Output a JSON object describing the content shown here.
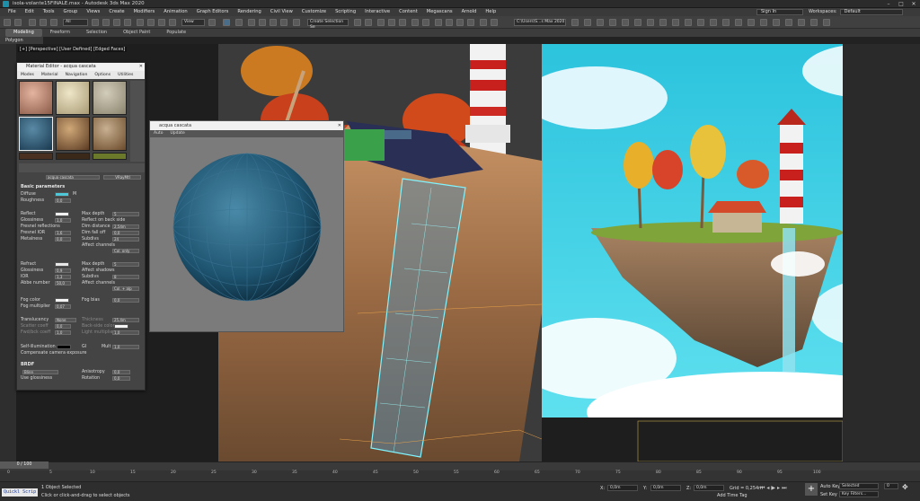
{
  "window": {
    "title": "isola-volante15FINALE.max - Autodesk 3ds Max 2020",
    "min": "–",
    "max": "□",
    "close": "✕"
  },
  "menu": [
    "File",
    "Edit",
    "Tools",
    "Group",
    "Views",
    "Create",
    "Modifiers",
    "Animation",
    "Graph Editors",
    "Rendering",
    "Civil View",
    "Customize",
    "Scripting",
    "Interactive",
    "Content",
    "Megascans",
    "Arnold",
    "Help"
  ],
  "signin": "Sign In",
  "workspace": {
    "label": "Workspaces:",
    "value": "Default"
  },
  "toolbar": {
    "view_dropdown": "View",
    "selection_set": "Create Selection Se",
    "path": "C:\\Users\\S...s Max 2020"
  },
  "ribbon": {
    "tabs": [
      "Modeling",
      "Freeform",
      "Selection",
      "Object Paint",
      "Populate"
    ],
    "active": "Modeling",
    "sub": "Polygon Modeling"
  },
  "viewport": {
    "label": "[+] [Perspective] [User Defined] [Edged Faces]"
  },
  "material_editor": {
    "title": "Material Editor - acqua cascata",
    "menu": [
      "Modes",
      "Material",
      "Navigation",
      "Options",
      "Utilities"
    ],
    "material_name": "acqua cascata",
    "material_type": "VRayMtl",
    "sections": {
      "basic": "Basic parameters",
      "brdf": "BRDF"
    },
    "diffuse": "Diffuse",
    "diffuse_m": "M",
    "roughness": {
      "label": "Roughness",
      "value": "0,0"
    },
    "reflect": "Reflect",
    "max_depth_1": {
      "label": "Max depth",
      "value": "5"
    },
    "glossiness_1": {
      "label": "Glossiness",
      "value": "1,0"
    },
    "reflect_back": "Reflect on back side",
    "fresnel": "Fresnel reflections",
    "dim_distance": {
      "label": "Dim distance",
      "value": "2,54m"
    },
    "fresnel_ior": {
      "label": "Fresnel IOR",
      "value": "1,6"
    },
    "dim_falloff": {
      "label": "Dim fall off",
      "value": "0,0"
    },
    "metalness": {
      "label": "Metalness",
      "value": "0,0"
    },
    "subdivs_1": {
      "label": "Subdivs",
      "value": "24"
    },
    "affect_channels_1": {
      "label": "Affect channels",
      "value": "Col. only"
    },
    "refract": "Refract",
    "max_depth_2": {
      "label": "Max depth",
      "value": "5"
    },
    "glossiness_2": {
      "label": "Glossiness",
      "value": "0,9"
    },
    "affect_shadows": "Affect shadows",
    "ior": {
      "label": "IOR",
      "value": "1,3"
    },
    "subdivs_2": {
      "label": "Subdivs",
      "value": "8"
    },
    "abbe": {
      "label": "Abbe number",
      "value": "50,0"
    },
    "affect_channels_2": {
      "label": "Affect channels",
      "value": "Col. + alp"
    },
    "fog_color": "Fog color",
    "fog_bias": {
      "label": "Fog bias",
      "value": "0,0"
    },
    "fog_multiplier": {
      "label": "Fog multiplier",
      "value": "0,07"
    },
    "translucency": {
      "label": "Translucency",
      "value": "None"
    },
    "thickness": {
      "label": "Thickness",
      "value": "25,4m"
    },
    "scatter_coeff": {
      "label": "Scatter coeff",
      "value": "0,0"
    },
    "back_side_color": "Back-side color",
    "fwd_bck_coeff": {
      "label": "Fwd/bck coeff",
      "value": "1,0"
    },
    "light_multiplier": {
      "label": "Light multiplier",
      "value": "1,0"
    },
    "self_illum": {
      "label": "Self-illumination",
      "gi": "GI",
      "mult_label": "Mult",
      "mult": "1,0"
    },
    "compensate": "Compensate camera exposure",
    "brdf_type": "Blinn",
    "anisotropy": {
      "label": "Anisotropy",
      "value": "0,0"
    },
    "use_glossiness": "Use glossiness",
    "rotation": {
      "label": "Rotation",
      "value": "0,0"
    }
  },
  "preview": {
    "title": "acqua cascata",
    "tabs": [
      "Auto",
      "Update"
    ]
  },
  "timeline": {
    "position": "0 / 100",
    "ticks": [
      "0",
      "5",
      "10",
      "15",
      "20",
      "25",
      "30",
      "35",
      "40",
      "45",
      "50",
      "55",
      "60",
      "65",
      "70",
      "75",
      "80",
      "85",
      "90",
      "95",
      "100"
    ]
  },
  "status": {
    "maxscript": "Quickl Scrip",
    "objects": "1 Object Selected",
    "prompt": "Click or click-and-drag to select objects",
    "x_label": "X:",
    "x": "0,0m",
    "y_label": "Y:",
    "y": "0,0m",
    "z_label": "Z:",
    "z": "0,0m",
    "grid": "Grid = 0,254m",
    "add_time_tag": "Add Time Tag",
    "auto_key": "Auto Key",
    "selected": "Selected",
    "set_key": "Set Key",
    "key_filters": "Key Filters...",
    "frame": "0"
  },
  "colors": {
    "accent": "#1d8fa8",
    "diffuse": "#4ec7d8",
    "sky": "#3fd3e6"
  }
}
